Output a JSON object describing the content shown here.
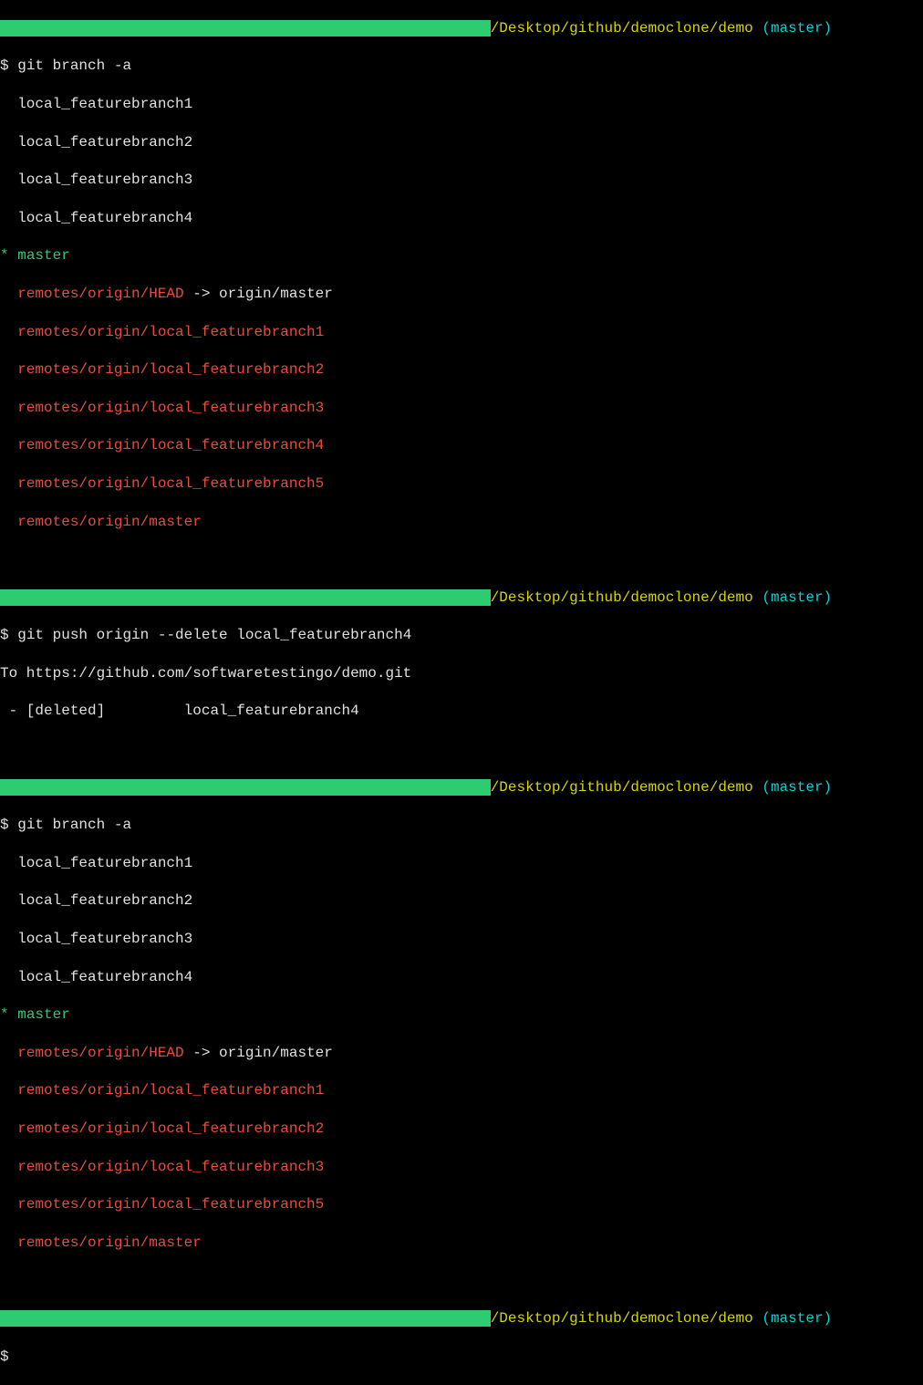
{
  "prompt": {
    "path": "/Desktop/github/democlone/demo",
    "branch_open": " (",
    "branch_name": "master",
    "branch_close": ")",
    "symbol": "$"
  },
  "block1": {
    "command": "git branch -a",
    "locals": [
      "local_featurebranch1",
      "local_featurebranch2",
      "local_featurebranch3",
      "local_featurebranch4"
    ],
    "current_marker": "*",
    "current": "master",
    "head_remote": "remotes/origin/HEAD",
    "head_arrow": " -> origin/master",
    "remotes": [
      "remotes/origin/local_featurebranch1",
      "remotes/origin/local_featurebranch2",
      "remotes/origin/local_featurebranch3",
      "remotes/origin/local_featurebranch4",
      "remotes/origin/local_featurebranch5",
      "remotes/origin/master"
    ]
  },
  "block2": {
    "command": "git push origin --delete local_featurebranch4",
    "output_line1": "To https://github.com/softwaretestingo/demo.git",
    "output_line2": " - [deleted]         local_featurebranch4"
  },
  "block3": {
    "command": "git branch -a",
    "locals": [
      "local_featurebranch1",
      "local_featurebranch2",
      "local_featurebranch3",
      "local_featurebranch4"
    ],
    "current_marker": "*",
    "current": "master",
    "head_remote": "remotes/origin/HEAD",
    "head_arrow": " -> origin/master",
    "remotes": [
      "remotes/origin/local_featurebranch1",
      "remotes/origin/local_featurebranch2",
      "remotes/origin/local_featurebranch3",
      "remotes/origin/local_featurebranch5",
      "remotes/origin/master"
    ]
  },
  "greenbar_fill": "                                                        "
}
